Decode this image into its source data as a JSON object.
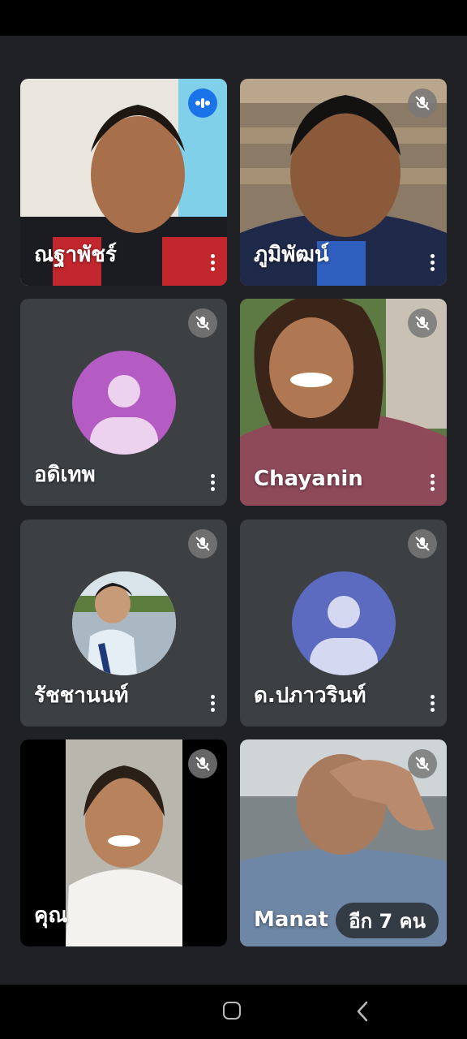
{
  "participants": [
    {
      "name": "ณฐาพัชร์",
      "mic": "speaking"
    },
    {
      "name": "ภูมิพัฒน์",
      "mic": "muted"
    },
    {
      "name": "อดิเทพ",
      "mic": "muted",
      "avatar_color": "#b55cc4"
    },
    {
      "name": "Chayanin",
      "mic": "muted"
    },
    {
      "name": "รัชชานนท์",
      "mic": "muted"
    },
    {
      "name": "ด.ปภาวรินท์",
      "mic": "muted",
      "avatar_color": "#5c6bc0"
    },
    {
      "name": "คุณ",
      "mic": "muted"
    },
    {
      "name": "Manat",
      "mic": "muted"
    }
  ],
  "more_participants_label": "อีก 7 คน",
  "colors": {
    "background": "#202124",
    "tile": "#3c4043",
    "speaking": "#1a73e8"
  }
}
